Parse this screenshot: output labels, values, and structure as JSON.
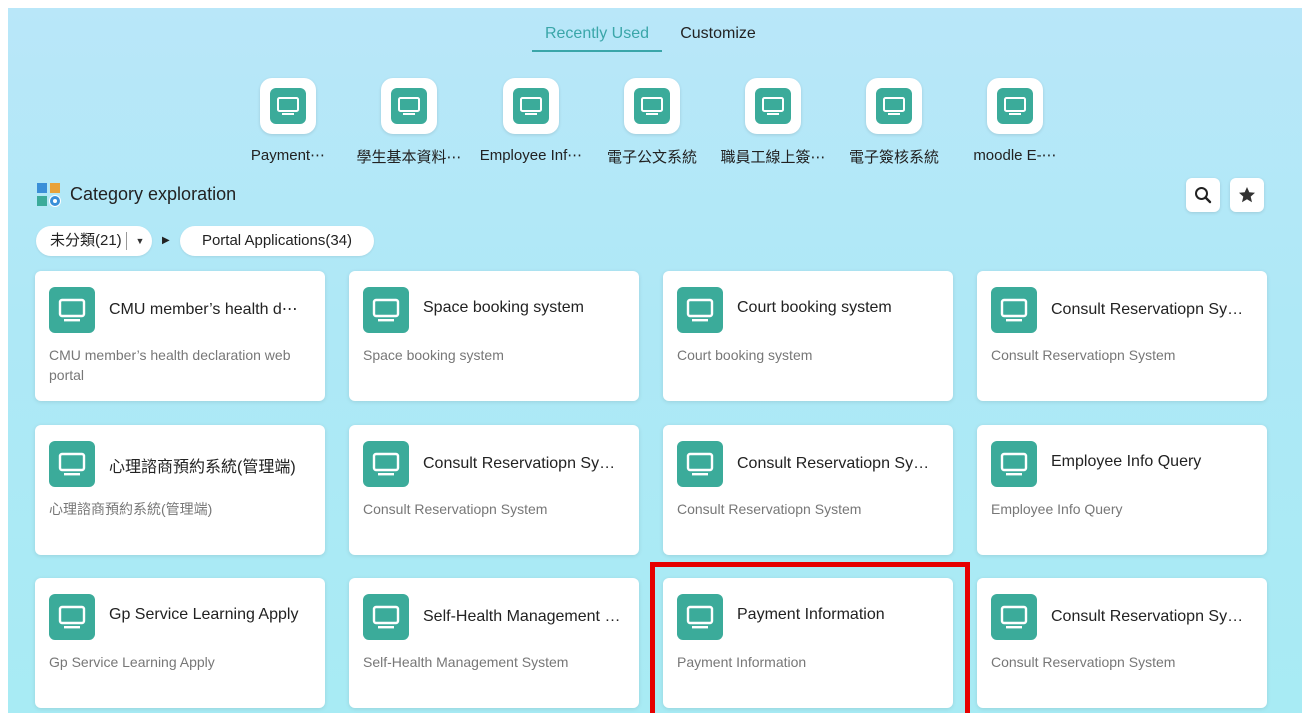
{
  "tabs": {
    "recent": "Recently Used",
    "customize": "Customize"
  },
  "recent_apps": [
    {
      "label": "Payment⋯",
      "icon": "monitor-icon"
    },
    {
      "label": "學生基本資料⋯",
      "icon": "monitor-icon"
    },
    {
      "label": "Employee Inf⋯",
      "icon": "monitor-icon"
    },
    {
      "label": "電子公文系統",
      "icon": "monitor-icon"
    },
    {
      "label": "職員工線上簽⋯",
      "icon": "monitor-icon"
    },
    {
      "label": "電子簽核系統",
      "icon": "monitor-icon"
    },
    {
      "label": "moodle E-⋯",
      "icon": "monitor-icon"
    }
  ],
  "category": {
    "title": "Category exploration",
    "icon": "category-grid-icon",
    "search_icon": "search-icon",
    "star_icon": "star-icon"
  },
  "breadcrumb": {
    "uncategorized": "未分類(21)",
    "current": "Portal Applications(34)"
  },
  "cards": [
    {
      "title": "CMU member’s health d⋯",
      "desc": "CMU member’s health declaration web portal"
    },
    {
      "title": "Space booking system",
      "desc": "Space booking system"
    },
    {
      "title": "Court booking system",
      "desc": "Court booking system"
    },
    {
      "title": "Consult Reservatiopn Syst⋯",
      "desc": "Consult Reservatiopn System"
    },
    {
      "title": "心理諮商預約系統(管理端)",
      "desc": "心理諮商預約系統(管理端)"
    },
    {
      "title": "Consult Reservatiopn Syst⋯",
      "desc": "Consult Reservatiopn System"
    },
    {
      "title": "Consult Reservatiopn Syst⋯",
      "desc": "Consult Reservatiopn System"
    },
    {
      "title": "Employee Info Query",
      "desc": "Employee Info Query"
    },
    {
      "title": "Gp Service Learning Apply",
      "desc": "Gp Service Learning Apply"
    },
    {
      "title": "Self-Health Management S⋯",
      "desc": "Self-Health Management System"
    },
    {
      "title": "Payment Information",
      "desc": "Payment Information"
    },
    {
      "title": "Consult Reservatiopn Syst⋯",
      "desc": "Consult Reservatiopn System"
    }
  ],
  "colors": {
    "accent": "#3aa6a9",
    "app_icon": "#3bab9a",
    "highlight": "#e60000"
  }
}
